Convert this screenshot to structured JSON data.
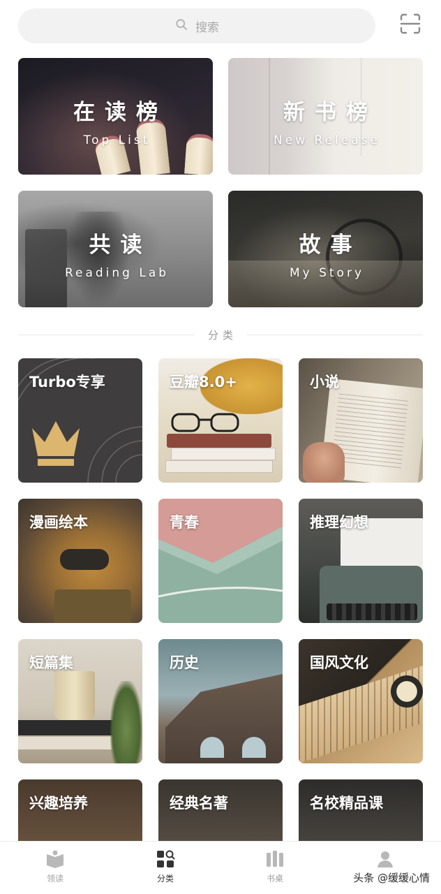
{
  "search": {
    "placeholder": "搜索"
  },
  "features": [
    {
      "title": "在读榜",
      "subtitle": "Top List"
    },
    {
      "title": "新书榜",
      "subtitle": "New Release"
    },
    {
      "title": "共读",
      "subtitle": "Reading Lab"
    },
    {
      "title": "故事",
      "subtitle": "My Story"
    }
  ],
  "section_title": "分类",
  "categories": [
    {
      "label": "Turbo专享"
    },
    {
      "label": "豆瓣8.0+"
    },
    {
      "label": "小说"
    },
    {
      "label": "漫画绘本"
    },
    {
      "label": "青春"
    },
    {
      "label": "推理幻想"
    },
    {
      "label": "短篇集"
    },
    {
      "label": "历史"
    },
    {
      "label": "国风文化"
    },
    {
      "label": "兴趣培养"
    },
    {
      "label": "经典名著"
    },
    {
      "label": "名校精品课"
    }
  ],
  "nav": [
    {
      "label": "领读",
      "icon": "book-open-icon"
    },
    {
      "label": "分类",
      "icon": "category-grid-icon",
      "active": true
    },
    {
      "label": "书桌",
      "icon": "bookshelf-icon"
    },
    {
      "label": "",
      "icon": "profile-icon"
    }
  ],
  "watermark": "头条 @缓缓心情",
  "colors": {
    "accent": "#333333",
    "muted": "#9e9e9e",
    "search_bg": "#f2f2f2"
  }
}
